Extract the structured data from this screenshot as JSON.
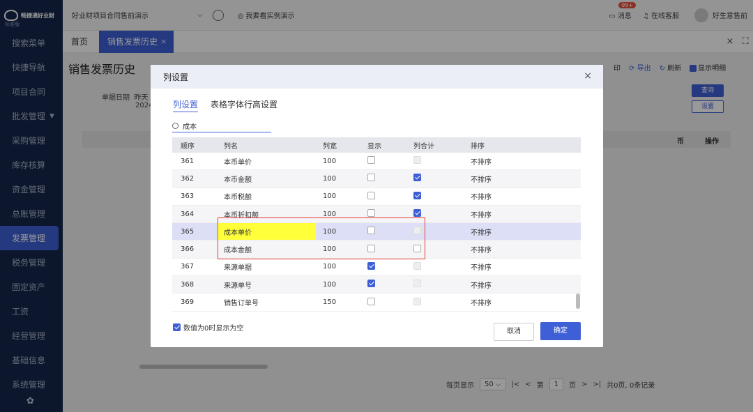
{
  "brand": {
    "name": "畅捷通好业财",
    "edition": "标准版"
  },
  "sidebar": {
    "items": [
      "搜索菜单",
      "快捷导航",
      "项目合同",
      "批发管理",
      "采购管理",
      "库存核算",
      "资金管理",
      "总账管理",
      "发票管理",
      "税务管理",
      "固定资产",
      "工资",
      "经营管理",
      "基础信息",
      "系统管理"
    ],
    "active": 8
  },
  "topbar": {
    "project": "好业财项目合同售前演示",
    "demo": "我要看实例演示",
    "msg": "消息",
    "badge": "99+",
    "service": "在线客服",
    "user": "好生意售前"
  },
  "tabs": {
    "home": "首页",
    "active": "销售发票历史"
  },
  "page": {
    "title": "销售发票历史",
    "toolbar": [
      "印",
      "导出",
      "刷新",
      "显示明细"
    ],
    "filter_label": "单据日期",
    "filter_value1": "昨天",
    "filter_value2": "2024",
    "query": "查询",
    "settings": "设置",
    "col1": "币",
    "col2": "操作"
  },
  "pager": {
    "per_page_label": "每页显示",
    "per_page": "50",
    "page_label": "第",
    "page_value": "1",
    "page_unit": "页",
    "summary": "共0页, 0条记录"
  },
  "dialog": {
    "title": "列设置",
    "tabs": [
      "列设置",
      "表格字体行高设置"
    ],
    "search": "成本",
    "headers": [
      "顺序",
      "列名",
      "列宽",
      "显示",
      "列合计",
      "排序"
    ],
    "rows": [
      {
        "ord": "361",
        "name": "本币单价",
        "w": "100",
        "show": false,
        "sum": "disabled",
        "sort": "不排序"
      },
      {
        "ord": "362",
        "name": "本币金额",
        "w": "100",
        "show": false,
        "sum": "checked",
        "sort": "不排序"
      },
      {
        "ord": "363",
        "name": "本币税额",
        "w": "100",
        "show": false,
        "sum": "checked",
        "sort": "不排序"
      },
      {
        "ord": "364",
        "name": "本币折扣额",
        "w": "100",
        "show": false,
        "sum": "checked",
        "sort": "不排序"
      },
      {
        "ord": "365",
        "name": "成本单价",
        "w": "100",
        "show": false,
        "sum": "disabled",
        "sort": "不排序"
      },
      {
        "ord": "366",
        "name": "成本金额",
        "w": "100",
        "show": false,
        "sum": "unchecked",
        "sort": "不排序"
      },
      {
        "ord": "367",
        "name": "来源单据",
        "w": "100",
        "show": true,
        "sum": "disabled",
        "sort": "不排序"
      },
      {
        "ord": "368",
        "name": "来源单号",
        "w": "100",
        "show": true,
        "sum": "disabled",
        "sort": "不排序"
      },
      {
        "ord": "369",
        "name": "销售订单号",
        "w": "150",
        "show": false,
        "sum": "disabled",
        "sort": "不排序"
      }
    ],
    "zero_blank": "数值为0时显示为空",
    "cancel": "取消",
    "ok": "确定"
  },
  "colors": {
    "primary": "#3f5fd6",
    "sidebar": "#15264c",
    "highlight": "#ffff3a",
    "annotation": "#e53935"
  }
}
